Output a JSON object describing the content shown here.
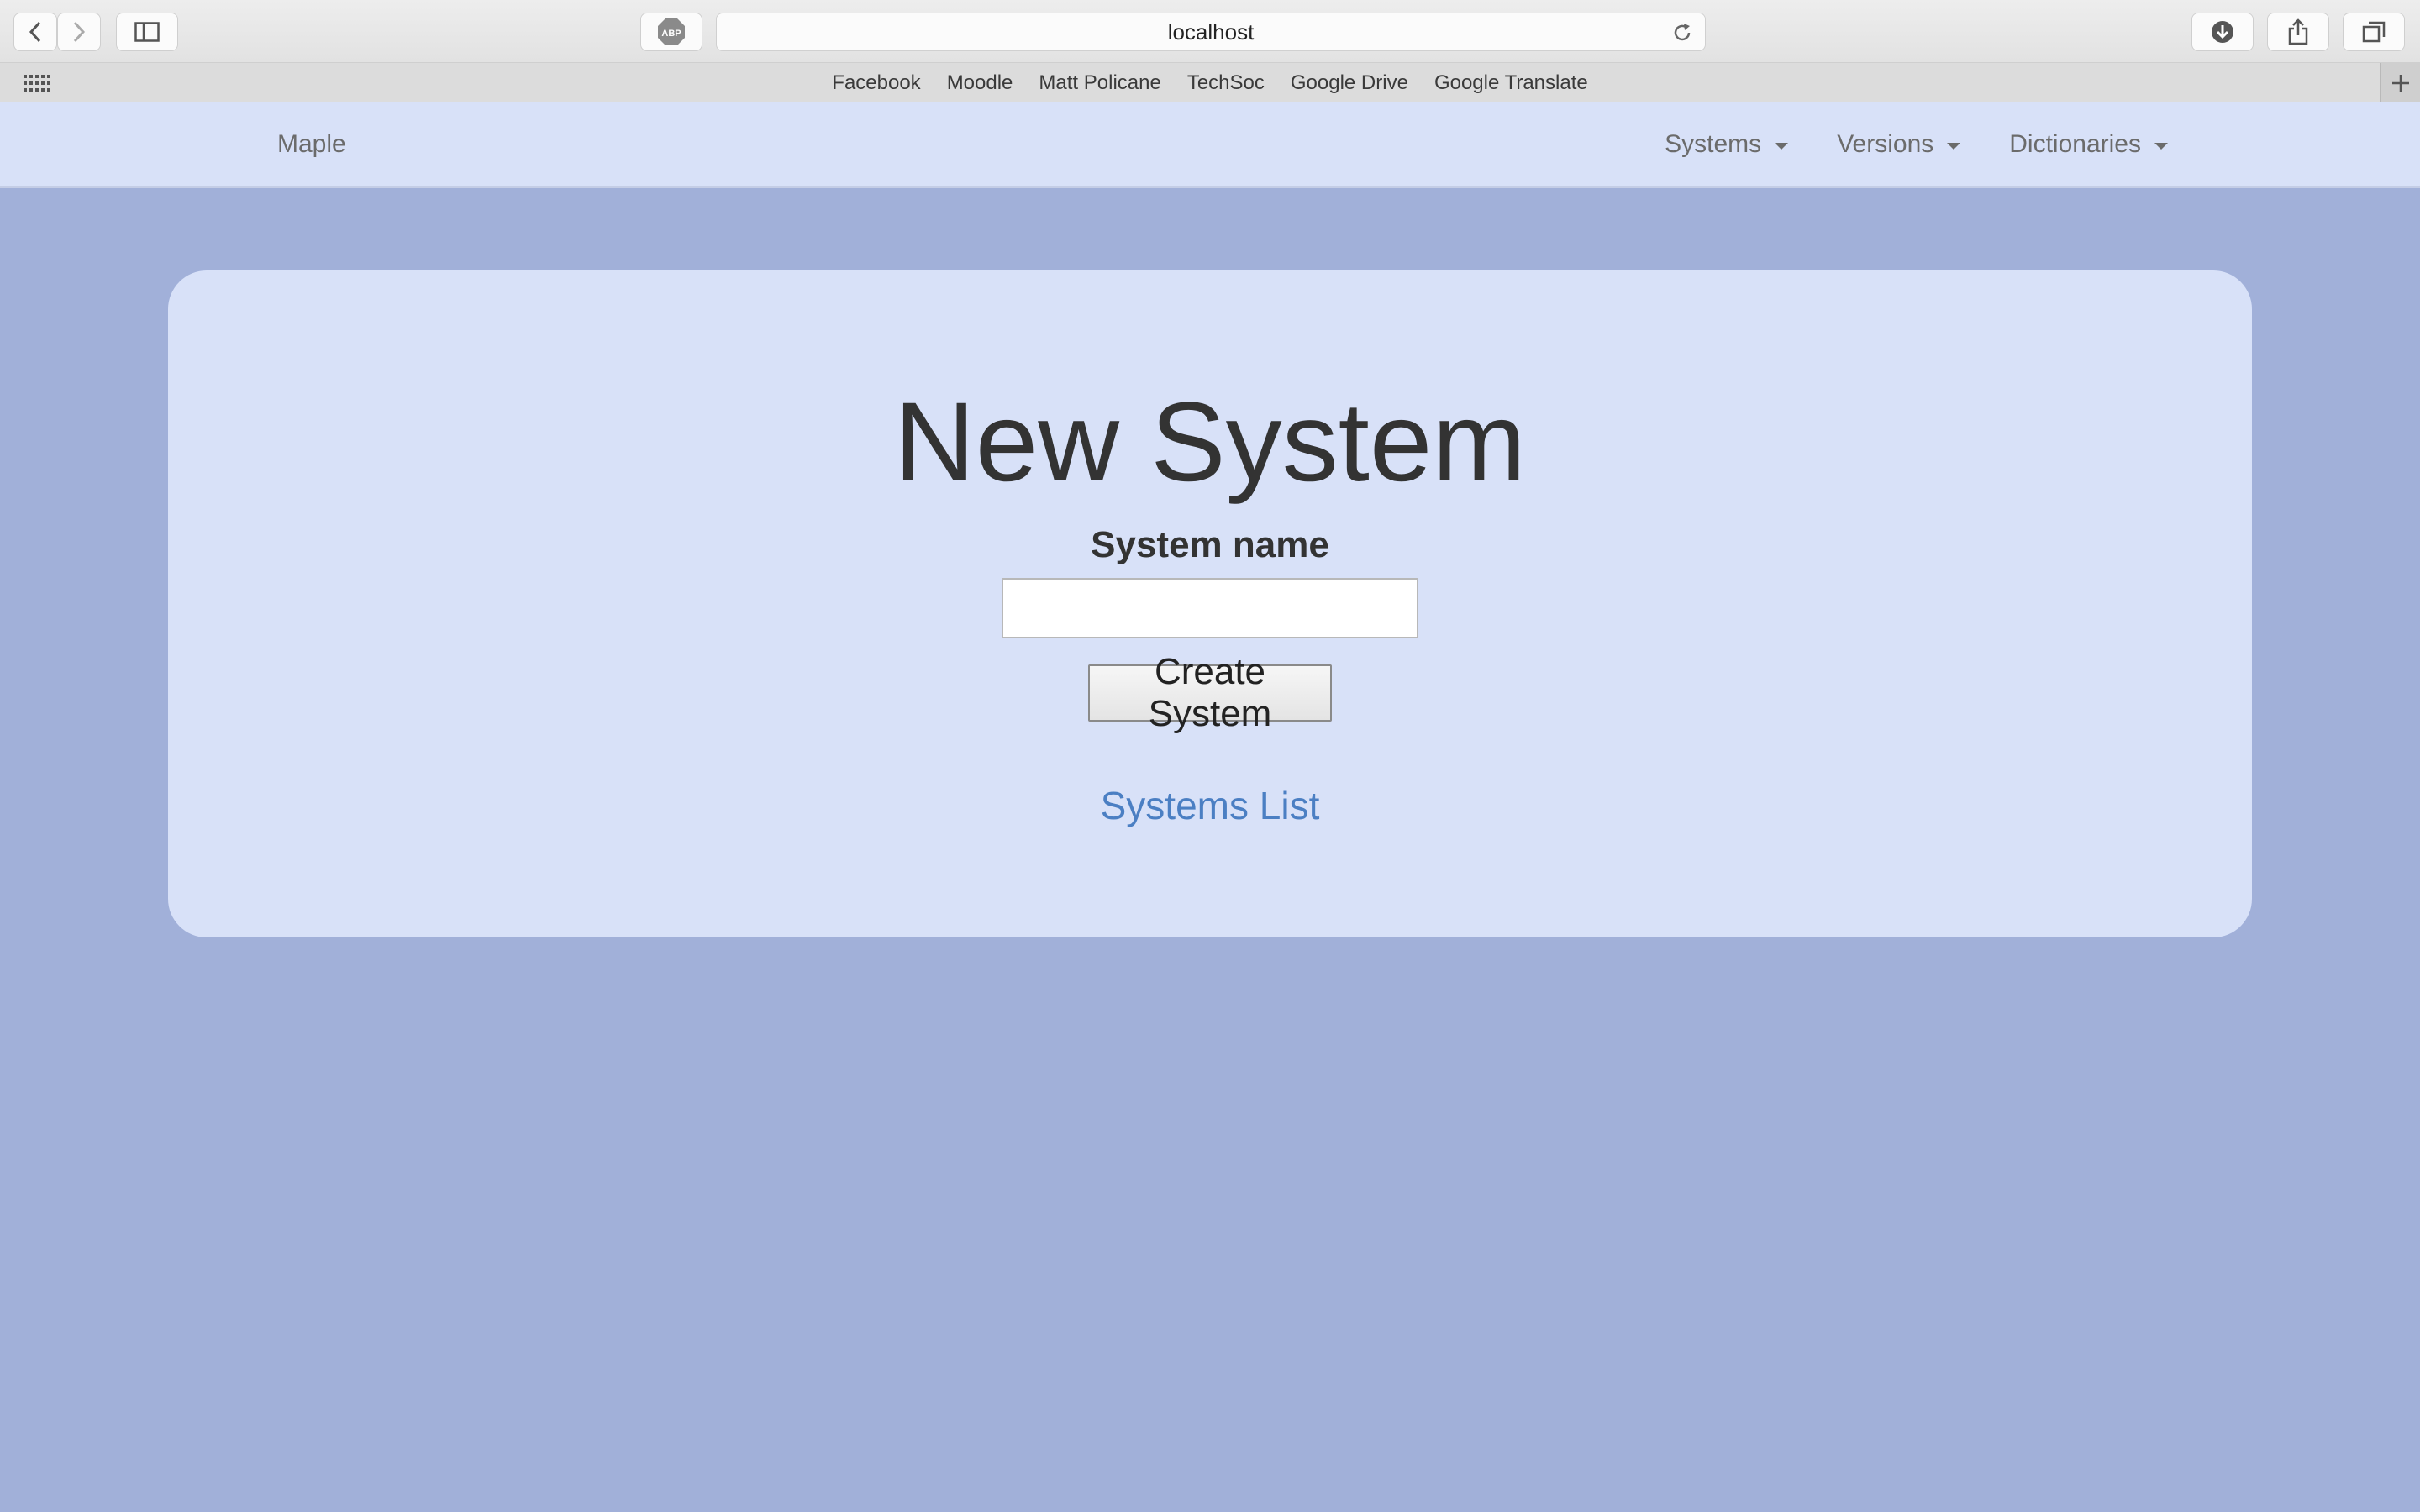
{
  "browser": {
    "url": "localhost",
    "adblock_label": "ABP",
    "bookmarks": [
      "Facebook",
      "Moodle",
      "Matt Policane",
      "TechSoc",
      "Google Drive",
      "Google Translate"
    ]
  },
  "navbar": {
    "brand": "Maple",
    "menus": [
      "Systems",
      "Versions",
      "Dictionaries"
    ]
  },
  "form": {
    "title": "New System",
    "label": "System name",
    "input_value": "",
    "submit_label": "Create System",
    "link_label": "Systems List"
  },
  "colors": {
    "page_background": "#a1b0d9",
    "card_background": "#d8e1f8",
    "link": "#4b7fc3"
  },
  "icons": [
    "back-icon",
    "forward-icon",
    "sidebar-icon",
    "adblock-icon",
    "reload-icon",
    "download-icon",
    "share-icon",
    "tabs-icon",
    "apps-grid-icon",
    "new-tab-icon",
    "caret-down-icon"
  ]
}
